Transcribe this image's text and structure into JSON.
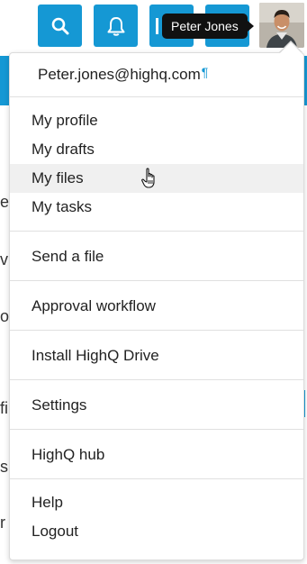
{
  "topbar": {
    "buttons": [
      {
        "icon": "search-icon"
      },
      {
        "icon": "bell-icon"
      },
      {
        "icon": "grid-icon"
      },
      {
        "icon": "user-icon"
      }
    ],
    "accent_color": "#1598d4"
  },
  "user": {
    "name": "Peter Jones",
    "email": "Peter.jones@highq.com"
  },
  "tooltip": {
    "text": "Peter Jones"
  },
  "menu": {
    "email_marker": "¶",
    "groups": [
      [
        "My profile",
        "My drafts",
        "My files",
        "My tasks"
      ],
      [
        "Send a file"
      ],
      [
        "Approval workflow"
      ],
      [
        "Install HighQ Drive"
      ],
      [
        "Settings"
      ],
      [
        "HighQ hub"
      ],
      [
        "Help",
        "Logout"
      ]
    ],
    "hovered_item": "My files"
  }
}
